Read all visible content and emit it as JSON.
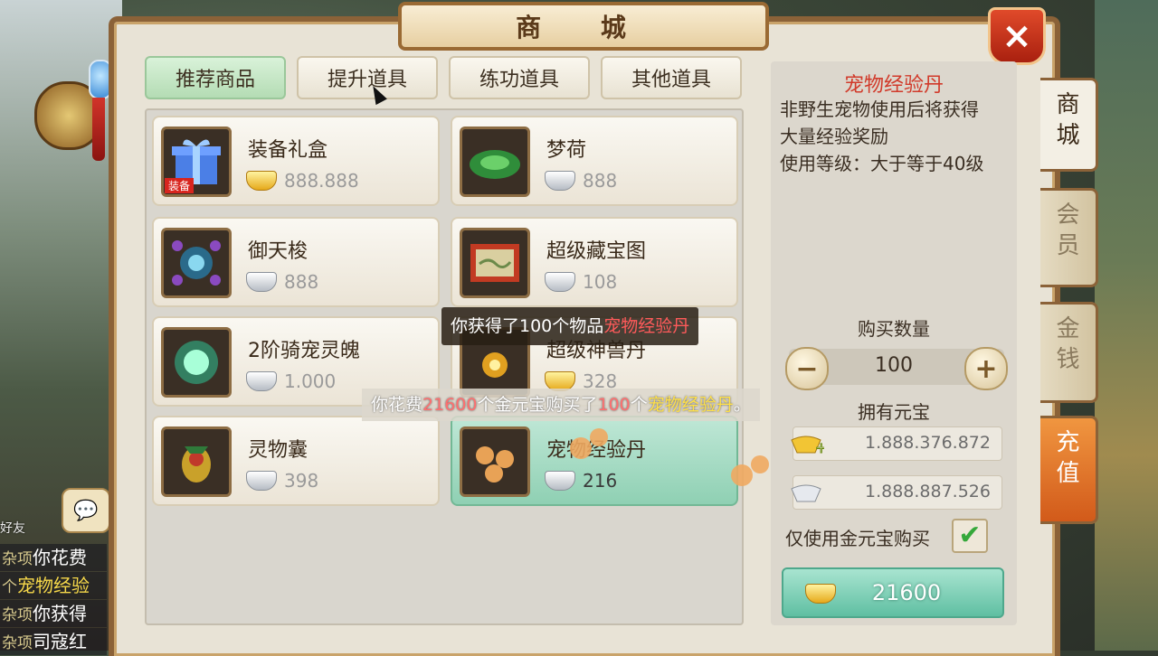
{
  "window": {
    "title": "商 城",
    "close_icon": "×"
  },
  "tabs": [
    {
      "label": "推荐商品",
      "active": true
    },
    {
      "label": "提升道具",
      "active": false
    },
    {
      "label": "练功道具",
      "active": false
    },
    {
      "label": "其他道具",
      "active": false
    }
  ],
  "items": [
    {
      "name": "装备礼盒",
      "price": "888.888",
      "currency": "gold",
      "badge": "装备"
    },
    {
      "name": "梦荷",
      "price": "888",
      "currency": "silver"
    },
    {
      "name": "御天梭",
      "price": "888",
      "currency": "silver"
    },
    {
      "name": "超级藏宝图",
      "price": "108",
      "currency": "silver"
    },
    {
      "name": "2阶骑宠灵魄",
      "price": "1.000",
      "currency": "silver"
    },
    {
      "name": "超级神兽丹",
      "price": "328",
      "currency": "gold"
    },
    {
      "name": "灵物囊",
      "price": "398",
      "currency": "silver"
    },
    {
      "name": "宠物经验丹",
      "price": "216",
      "currency": "silver",
      "selected": true
    }
  ],
  "notifications": {
    "obtained_prefix": "你获得了100个物品",
    "obtained_item": "宠物经验丹",
    "spent_prefix": "你花费",
    "spent_amount": "21600",
    "spent_mid": "个金元宝购买了",
    "spent_count": "100",
    "spent_unit": "个",
    "spent_item": "宠物经验丹",
    "spent_end": "。"
  },
  "detail": {
    "title": "宠物经验丹",
    "desc_line1": "非野生宠物使用后将获得",
    "desc_line2": "大量经验奖励",
    "desc_line3": "使用等级：大于等于40级",
    "qty_label": "购买数量",
    "qty_value": "100",
    "minus": "−",
    "plus": "+",
    "own_label": "拥有元宝",
    "gold_amount": "1.888.376.872",
    "silver_amount": "1.888.887.526",
    "only_gold_label": "仅使用金元宝购买",
    "checkbox_mark": "✔",
    "buy_amount": "21600"
  },
  "side_tabs": [
    {
      "label_top": "商",
      "label_bottom": "城",
      "active": true
    },
    {
      "label_top": "会",
      "label_bottom": "员",
      "active": false
    },
    {
      "label_top": "金",
      "label_bottom": "钱",
      "active": false
    },
    {
      "label_top": "充",
      "label_bottom": "值",
      "active": false
    }
  ],
  "chat": {
    "friend_label": "好友",
    "bubble_icon": "💬",
    "lines": [
      {
        "tag": "杂项",
        "text": "你花费"
      },
      {
        "tag": "个",
        "text": "宠物经验"
      },
      {
        "tag": "杂项",
        "text": "你获得"
      },
      {
        "tag": "杂项",
        "text": "司寇红"
      }
    ]
  },
  "colors": {
    "accent_red": "#d13a2a",
    "selected_green": "#8fd0b3",
    "frame_brown": "#8b6238"
  }
}
